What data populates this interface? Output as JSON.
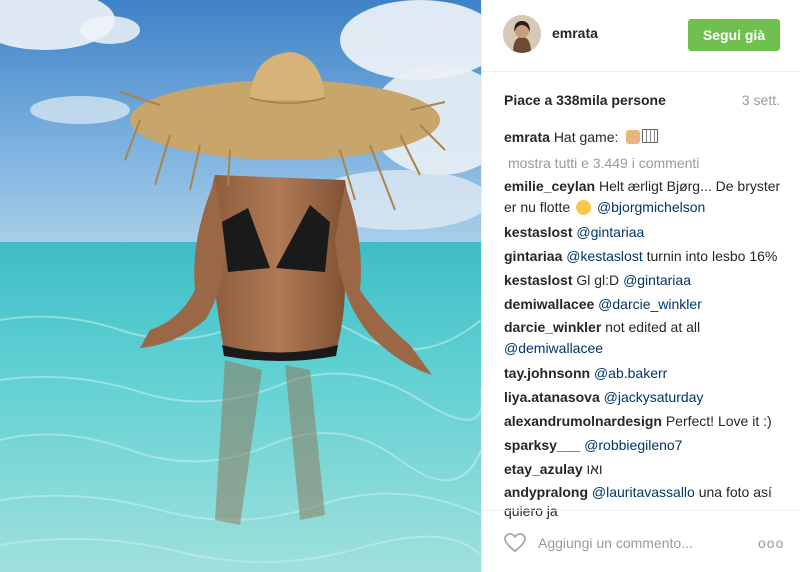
{
  "post": {
    "username": "emrata",
    "follow_label": "Segui già",
    "likes": "Piace a 338mila persone",
    "time_ago": "3 sett.",
    "caption": {
      "user": "emrata",
      "text": "Hat game:"
    },
    "view_all": "mostra tutti e 3.449 i commenti",
    "add_comment_placeholder": "Aggiungi un commento...",
    "more_icon": "ooo"
  },
  "comments": [
    {
      "user": "emilie_ceylan",
      "text1": "Helt ærligt Bjørg... De bryster er nu flotte",
      "mention": "@bjorgmichelson"
    },
    {
      "user": "kestaslost",
      "mention": "@gintariaa"
    },
    {
      "user": "gintariaa",
      "mention": "@kestaslost",
      "text": "turnin into lesbo 16%"
    },
    {
      "user": "kestaslost",
      "text": "Gl gl:D",
      "mention": "@gintariaa"
    },
    {
      "user": "demiwallacee",
      "mention": "@darcie_winkler"
    },
    {
      "user": "darcie_winkler",
      "text": "not edited at all",
      "mention": "@demiwallacee"
    },
    {
      "user": "tay.johnsonn",
      "mention": "@ab.bakerr"
    },
    {
      "user": "liya.atanasova",
      "mention": "@jackysaturday"
    },
    {
      "user": "alexandrumolnardesign",
      "text": "Perfect! Love it :)"
    },
    {
      "user": "sparksy___",
      "mention": "@robbiegileno7"
    },
    {
      "user": "etay_azulay",
      "text": "ואו"
    },
    {
      "user": "andypralong",
      "mention": "@lauritavassallo",
      "text": "una foto así quiero ja"
    }
  ],
  "colors": {
    "follow_bg": "#70c050",
    "mention": "#003569",
    "muted": "#999999"
  },
  "icons": [
    "heart-icon",
    "more-options-icon",
    "flexed-arm-emoji",
    "calendar-emoji",
    "relieved-face-emoji"
  ]
}
